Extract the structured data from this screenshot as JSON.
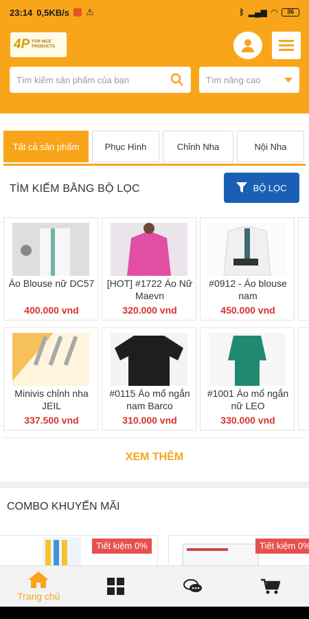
{
  "status_bar": {
    "time": "23:14",
    "net_speed": "0,5KB/s",
    "battery": "36"
  },
  "header": {
    "logo_mark": "4P",
    "logo_text_line1": "FOR NICE",
    "logo_text_line2": "PRODUCTS",
    "search_placeholder": "Tìm kiếm sản phẩm của bạn",
    "advanced_search_label": "Tìm nâng cao"
  },
  "tabs": [
    {
      "label": "Tất cả sản phẩm",
      "active": true
    },
    {
      "label": "Phục Hình",
      "active": false
    },
    {
      "label": "Chỉnh Nha",
      "active": false
    },
    {
      "label": "Nội Nha",
      "active": false
    }
  ],
  "filter": {
    "title": "TÌM KIẾM BẰNG BỘ LỌC",
    "button_label": "BỘ LỌC"
  },
  "products": [
    {
      "name": "Áo Blouse nữ DC57",
      "price": "400.000 vnd",
      "image": "white-blouse"
    },
    {
      "name": "[HOT] #1722 Áo Nữ Maevn",
      "price": "320.000 vnd",
      "image": "pink-scrub"
    },
    {
      "name": "#0912 - Áo blouse nam",
      "price": "450.000 vnd",
      "image": "white-coat"
    },
    {
      "name": "Minivis chỉnh nha JEIL",
      "price": "337.500 vnd",
      "image": "screws"
    },
    {
      "name": "#0115 Áo mổ ngắn nam Barco",
      "price": "310.000 vnd",
      "image": "black-scrub"
    },
    {
      "name": "#1001 Áo mổ ngắn nữ LEO",
      "price": "330.000 vnd",
      "image": "green-scrub"
    }
  ],
  "see_more": "XEM THÊM",
  "combo": {
    "title": "COMBO KHUYẾN MÃI",
    "badge1": "Tiết kiệm 0%",
    "badge2": "Tiết kiệm 0%"
  },
  "bottom_nav": {
    "home_label": "Trang chủ"
  },
  "colors": {
    "accent": "#f9a51a",
    "filter_button": "#1a5fb4",
    "price": "#d9302b",
    "badge": "#e5514c"
  }
}
